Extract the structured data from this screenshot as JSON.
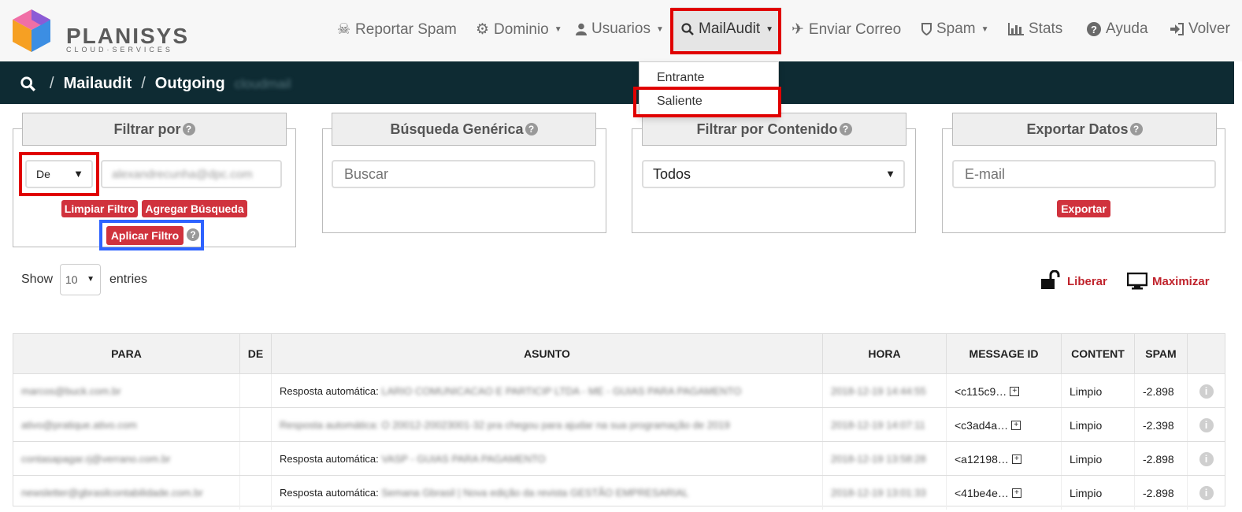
{
  "brand": {
    "name": "PLANISYS",
    "sub": "CLOUD·SERVICES"
  },
  "nav": {
    "reportar_spam": "Reportar Spam",
    "dominio": "Dominio",
    "usuarios": "Usuarios",
    "mailaudit": "MailAudit",
    "enviar_correo": "Enviar Correo",
    "spam": "Spam",
    "stats": "Stats",
    "ayuda": "Ayuda",
    "volver": "Volver"
  },
  "breadcrumb": {
    "level1": "Mailaudit",
    "level2": "Outgoing",
    "extra": "cloudmail"
  },
  "dropdown": {
    "entrante": "Entrante",
    "saliente": "Saliente"
  },
  "filters": {
    "filtrar_por": {
      "title": "Filtrar por",
      "field_select": "De",
      "value": "alexandrecunha@dpc.com",
      "limpiar": "Limpiar Filtro",
      "agregar": "Agregar Búsqueda",
      "aplicar": "Aplicar Filtro"
    },
    "busqueda": {
      "title": "Búsqueda Genérica",
      "placeholder": "Buscar"
    },
    "contenido": {
      "title": "Filtrar por Contenido",
      "selected": "Todos"
    },
    "exportar": {
      "title": "Exportar Datos",
      "placeholder": "E-mail",
      "button": "Exportar"
    }
  },
  "entries": {
    "show": "Show",
    "value": "10",
    "entries": "entries"
  },
  "actions": {
    "liberar": "Liberar",
    "maximizar": "Maximizar"
  },
  "table": {
    "headers": [
      "PARA",
      "DE",
      "ASUNTO",
      "HORA",
      "MESSAGE ID",
      "CONTENT",
      "SPAM"
    ],
    "rows": [
      {
        "para": "marcos@buck.com.br",
        "de": "",
        "asunto_prefix": "Resposta automática:",
        "asunto": "LARIO COMUNICACAO E PARTICIP LTDA - ME - GUIAS PARA PAGAMENTO",
        "hora": "2018-12-19 14:44:55",
        "message_id": "<c115c9…",
        "content": "Limpio",
        "spam": "-2.898"
      },
      {
        "para": "ativo@pratique.ativo.com",
        "de": "",
        "asunto_prefix": "",
        "asunto": "Resposta automática: O 20012-20023001-32 pra chegou para ajudar na sua programação de 2019",
        "hora": "2018-12-19 14:07:11",
        "message_id": "<c3ad4a…",
        "content": "Limpio",
        "spam": "-2.398"
      },
      {
        "para": "contasapagar.rj@verrano.com.br",
        "de": "",
        "asunto_prefix": "Resposta automática:",
        "asunto": "VASP - GUIAS PARA PAGAMENTO",
        "hora": "2018-12-19 13:58:28",
        "message_id": "<a12198…",
        "content": "Limpio",
        "spam": "-2.898"
      },
      {
        "para": "newsletter@gbrasilcontabilidade.com.br",
        "de": "",
        "asunto_prefix": "Resposta automática:",
        "asunto": "Semana Gbrasil | Nova edição da revista GESTÃO EMPRESARIAL",
        "hora": "2018-12-19 13:01:33",
        "message_id": "<41be4e…",
        "content": "Limpio",
        "spam": "-2.898"
      }
    ]
  },
  "colors": {
    "navbar_bg": "#f7f7f7",
    "crumb_bg": "#0e2b33",
    "button_red": "#d0323d",
    "highlight_red": "#e00000",
    "highlight_blue": "#2e63ff"
  }
}
